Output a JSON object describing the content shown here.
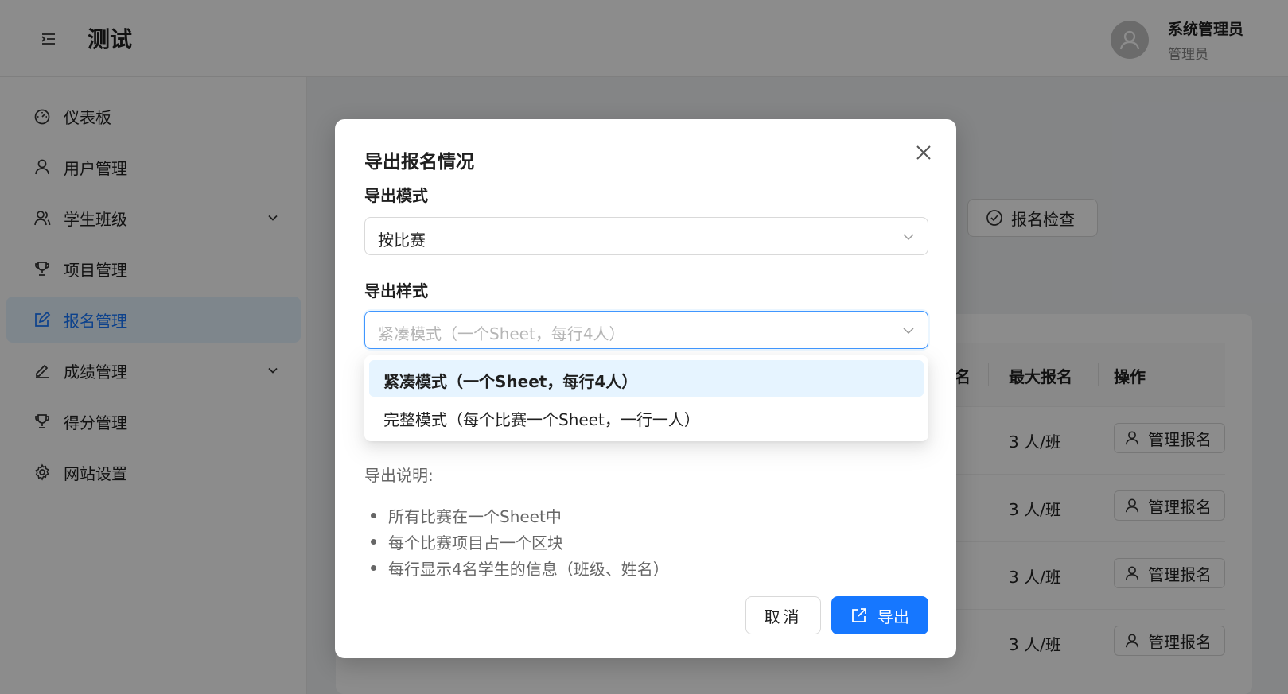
{
  "header": {
    "title": "测试",
    "user_name": "系统管理员",
    "user_role": "管理员"
  },
  "sidebar": {
    "items": [
      {
        "label": "仪表板",
        "icon": "dashboard-icon"
      },
      {
        "label": "用户管理",
        "icon": "user-icon"
      },
      {
        "label": "学生班级",
        "icon": "team-icon",
        "expandable": true
      },
      {
        "label": "项目管理",
        "icon": "trophy-icon"
      },
      {
        "label": "报名管理",
        "icon": "edit-icon",
        "active": true
      },
      {
        "label": "成绩管理",
        "icon": "pen-icon",
        "expandable": true
      },
      {
        "label": "得分管理",
        "icon": "trophy-icon"
      },
      {
        "label": "网站设置",
        "icon": "gear-icon"
      }
    ]
  },
  "background": {
    "check_button": "报名检查",
    "table": {
      "headers": [
        "名",
        "最大报名",
        "操作"
      ],
      "rows": [
        {
          "max": "3 人/班",
          "action": "管理报名"
        },
        {
          "max": "3 人/班",
          "action": "管理报名"
        },
        {
          "max": "3 人/班",
          "action": "管理报名"
        },
        {
          "max": "3 人/班",
          "action": "管理报名"
        }
      ]
    }
  },
  "modal": {
    "title": "导出报名情况",
    "mode_label": "导出模式",
    "mode_value": "按比赛",
    "style_label": "导出样式",
    "style_placeholder": "紧凑模式（一个Sheet，每行4人）",
    "style_options": [
      {
        "label": "紧凑模式（一个Sheet，每行4人）",
        "selected": true
      },
      {
        "label": "完整模式（每个比赛一个Sheet，一行一人）",
        "selected": false
      }
    ],
    "desc_title": "导出说明:",
    "desc_items": [
      "所有比赛在一个Sheet中",
      "每个比赛项目占一个区块",
      "每行显示4名学生的信息（班级、姓名）"
    ],
    "cancel_label": "取消",
    "export_label": "导出"
  },
  "colors": {
    "primary": "#1677ff",
    "active_bg": "#e6f4ff",
    "mask": "rgba(0,0,0,0.45)"
  }
}
